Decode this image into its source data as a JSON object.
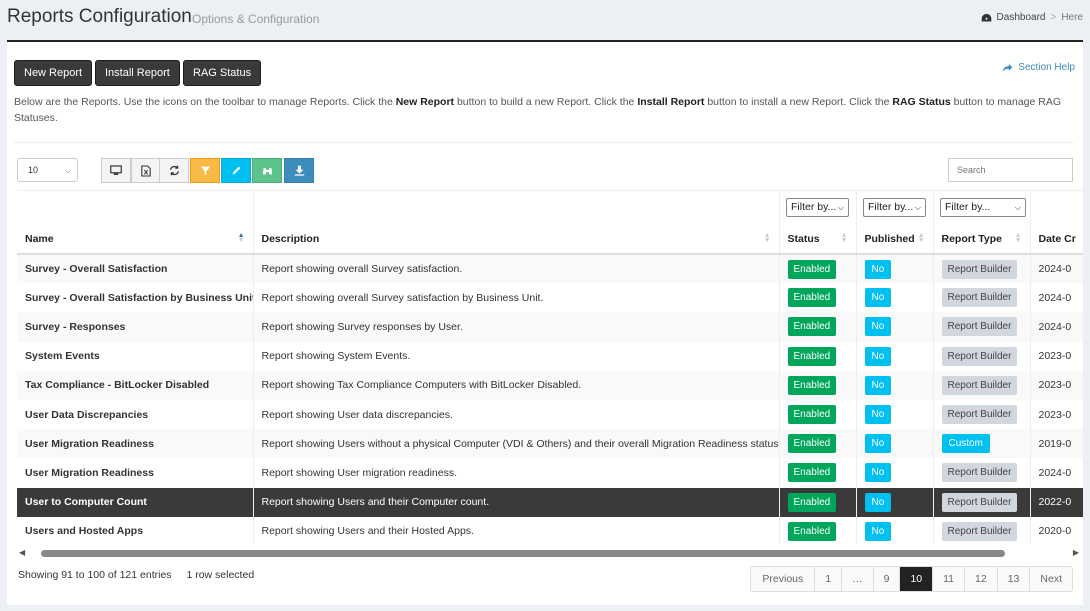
{
  "header": {
    "title": "Reports Configuration",
    "subtitle": "Options & Configuration",
    "breadcrumb": [
      "Dashboard",
      "Here"
    ],
    "breadcrumb_sep": ">"
  },
  "toolbar": {
    "new_report": "New Report",
    "install_report": "Install Report",
    "rag_status": "RAG Status",
    "section_help": "Section Help"
  },
  "intro": {
    "p1": "Below are the Reports. Use the icons on the toolbar to manage Reports. Click the ",
    "b1": "New Report",
    "p2": " button to build a new Report. Click the ",
    "b2": "Install Report",
    "p3": " button to install a new Report. Click the ",
    "b3": "RAG Status",
    "p4": " button to manage RAG Statuses."
  },
  "table_controls": {
    "page_length": "10",
    "search_placeholder": "Search",
    "filter_placeholder": "Filter by...",
    "icons": [
      "monitor-icon",
      "excel-icon",
      "refresh-icon",
      "filter-icon",
      "edit-icon",
      "binoculars-icon",
      "download-icon"
    ]
  },
  "columns": [
    "Name",
    "Description",
    "Status",
    "Published",
    "Report Type",
    "Date Cr"
  ],
  "rows": [
    {
      "name": "Survey - Overall Satisfaction",
      "description": "Report showing overall Survey satisfaction.",
      "status": "Enabled",
      "published": "No",
      "type": "Report Builder",
      "date": "2024-0"
    },
    {
      "name": "Survey - Overall Satisfaction by Business Unit",
      "description": "Report showing overall Survey satisfaction by Business Unit.",
      "status": "Enabled",
      "published": "No",
      "type": "Report Builder",
      "date": "2024-0"
    },
    {
      "name": "Survey - Responses",
      "description": "Report showing Survey responses by User.",
      "status": "Enabled",
      "published": "No",
      "type": "Report Builder",
      "date": "2024-0"
    },
    {
      "name": "System Events",
      "description": "Report showing System Events.",
      "status": "Enabled",
      "published": "No",
      "type": "Report Builder",
      "date": "2023-0"
    },
    {
      "name": "Tax Compliance - BitLocker Disabled",
      "description": "Report showing Tax Compliance Computers with BitLocker Disabled.",
      "status": "Enabled",
      "published": "No",
      "type": "Report Builder",
      "date": "2023-0"
    },
    {
      "name": "User Data Discrepancies",
      "description": "Report showing User data discrepancies.",
      "status": "Enabled",
      "published": "No",
      "type": "Report Builder",
      "date": "2023-0"
    },
    {
      "name": "User Migration Readiness",
      "description": "Report showing Users without a physical Computer (VDI & Others) and their overall Migration Readiness status.",
      "status": "Enabled",
      "published": "No",
      "type": "Custom",
      "date": "2019-0"
    },
    {
      "name": "User Migration Readiness",
      "description": "Report showing User migration readiness.",
      "status": "Enabled",
      "published": "No",
      "type": "Report Builder",
      "date": "2024-0"
    },
    {
      "name": "User to Computer Count",
      "description": "Report showing Users and their Computer count.",
      "status": "Enabled",
      "published": "No",
      "type": "Report Builder",
      "date": "2022-0"
    },
    {
      "name": "Users and Hosted Apps",
      "description": "Report showing Users and their Hosted Apps.",
      "status": "Enabled",
      "published": "No",
      "type": "Report Builder",
      "date": "2020-0"
    }
  ],
  "selected_row_index": 8,
  "footer": {
    "info": "Showing 91 to 100 of 121 entries",
    "selected": "1 row selected"
  },
  "pagination": [
    "Previous",
    "1",
    "…",
    "9",
    "10",
    "11",
    "12",
    "13",
    "Next"
  ],
  "active_page": "10",
  "colors": {
    "enabled": "#00a65a",
    "published_no": "#00c0ef",
    "report_builder": "#d2d6de",
    "custom": "#00c0ef",
    "dark_button": "#3a3a3a",
    "selected_row": "#3a3a3a"
  }
}
